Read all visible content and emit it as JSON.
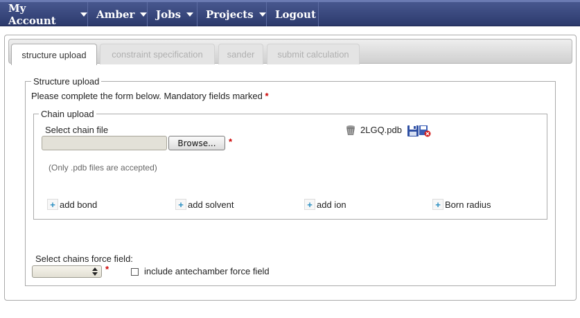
{
  "nav": {
    "items": [
      {
        "label": "My Account",
        "has_caret": true
      },
      {
        "label": "Amber",
        "has_caret": true
      },
      {
        "label": "Jobs",
        "has_caret": true
      },
      {
        "label": "Projects",
        "has_caret": true
      },
      {
        "label": "Logout",
        "has_caret": false
      }
    ]
  },
  "tabs": [
    {
      "label": "structure upload",
      "active": true
    },
    {
      "label": "constraint specification",
      "active": false
    },
    {
      "label": "sander",
      "active": false
    },
    {
      "label": "submit calculation",
      "active": false
    }
  ],
  "structure_upload": {
    "legend": "Structure upload",
    "instructions": "Please complete the form below. Mandatory fields marked",
    "required_marker": "*"
  },
  "chain_upload": {
    "legend": "Chain upload",
    "select_label": "Select chain file",
    "browse_label": "Browse...",
    "note": "(Only .pdb files are accepted)",
    "uploaded_file": "2LGQ.pdb",
    "icons": [
      "trash-icon",
      "save-icon",
      "delete-file-icon"
    ]
  },
  "add_links": [
    {
      "plus": "+",
      "label": "add bond"
    },
    {
      "plus": "+",
      "label": "add solvent"
    },
    {
      "plus": "+",
      "label": "add ion"
    },
    {
      "plus": "+",
      "label": "Born radius"
    }
  ],
  "force_field": {
    "label": "Select chains force field:",
    "selected_value": "",
    "checkbox_label": "include antechamber force field",
    "checkbox_checked": false
  },
  "colors": {
    "nav_background": "#2c3a6c",
    "required": "#cc0000",
    "plus_icon": "#2b8fc2"
  }
}
